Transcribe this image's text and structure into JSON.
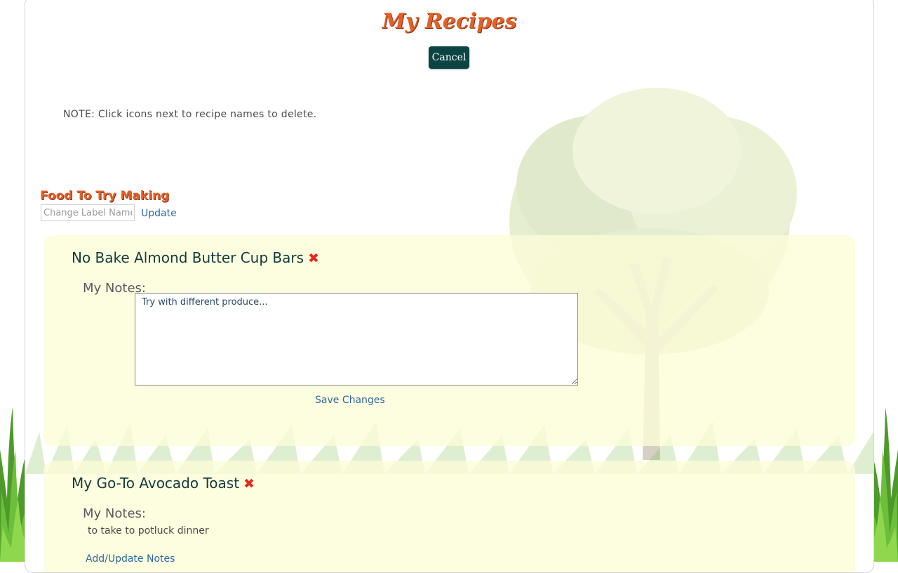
{
  "page": {
    "title": "My Recipes",
    "cancel_label": "Cancel",
    "note": "NOTE: Click icons next to recipe names to delete."
  },
  "label_section": {
    "title": "Food To Try Making",
    "input_placeholder": "Change Label Name",
    "input_value": "",
    "update_label": "Update"
  },
  "recipes": [
    {
      "name": "No Bake Almond Butter Cup Bars",
      "delete_icon": "x-mark-icon",
      "notes_label": "My Notes:",
      "notes_value": "Try with different produce...",
      "save_label": "Save Changes"
    },
    {
      "name": "My Go-To Avocado Toast",
      "delete_icon": "x-mark-icon",
      "notes_label": "My Notes:",
      "notes_value": "to take to potluck dinner",
      "add_label": "Add/Update Notes"
    }
  ],
  "colors": {
    "title": "#e2612a",
    "button_bg": "#0c4443",
    "link": "#2d6a9f",
    "card_bg": "#fcfcd7",
    "delete": "#e8291b"
  }
}
